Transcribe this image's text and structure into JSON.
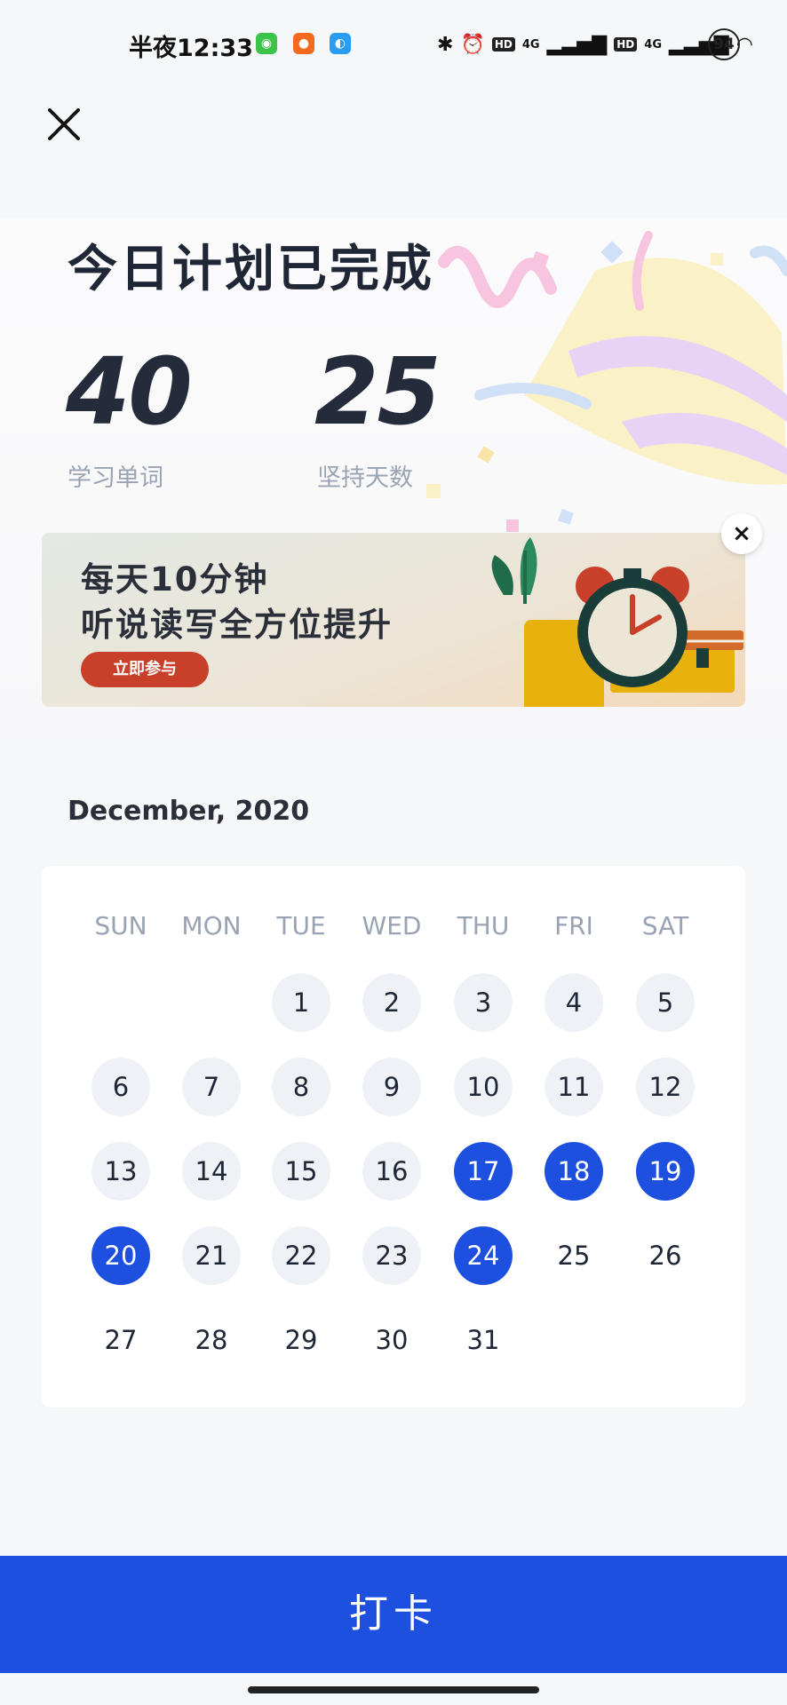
{
  "status_bar": {
    "time": "半夜12:33",
    "battery": "94",
    "signal_1": "4G",
    "signal_2": "4G",
    "hd_1": "HD",
    "hd_2": "HD"
  },
  "header": {
    "close_icon": "close-icon"
  },
  "summary": {
    "title": "今日计划已完成",
    "words_count": "40",
    "words_label": "学习单词",
    "streak_count": "25",
    "streak_label": "坚持天数"
  },
  "banner": {
    "line1": "每天10分钟",
    "line2": "听说读写全方位提升",
    "button_label": "立即参与",
    "close_label": "×"
  },
  "calendar": {
    "month_label": "December, 2020",
    "weekdays": [
      "SUN",
      "MON",
      "TUE",
      "WED",
      "THU",
      "FRI",
      "SAT"
    ],
    "first_weekday_index": 2,
    "days_in_month": 31,
    "today": 24,
    "checked_in_days": [
      17,
      18,
      19,
      20,
      24
    ],
    "colors": {
      "checked": "#1e50e0",
      "past": "#eef1f6"
    }
  },
  "footer": {
    "checkin_label": "打卡"
  },
  "colors": {
    "primary": "#1e50e0",
    "title": "#1f2635",
    "muted": "#9aa3b3",
    "banner_button": "#c8402a"
  }
}
